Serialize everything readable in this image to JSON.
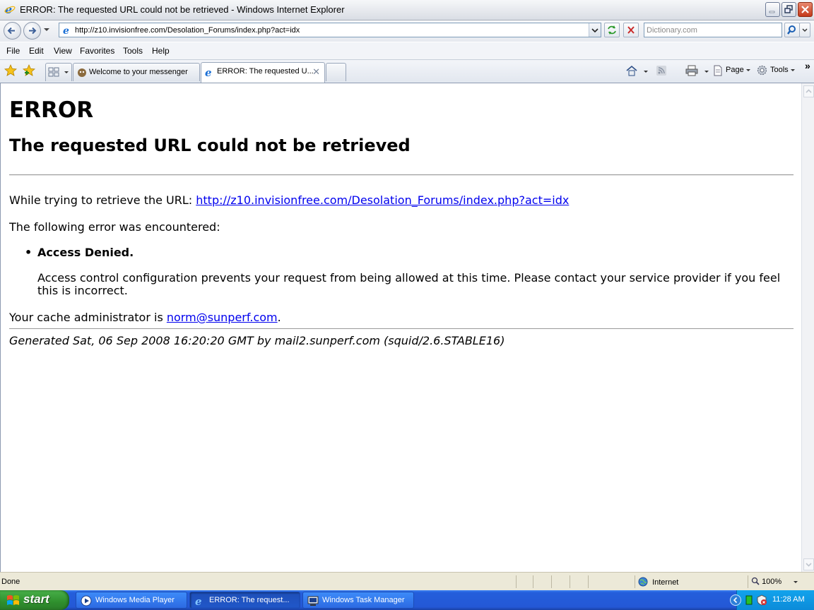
{
  "window": {
    "title": "ERROR: The requested URL could not be retrieved - Windows Internet Explorer"
  },
  "address": {
    "url": "http://z10.invisionfree.com/Desolation_Forums/index.php?act=idx"
  },
  "search": {
    "placeholder": "Dictionary.com"
  },
  "menu": {
    "items": [
      "File",
      "Edit",
      "View",
      "Favorites",
      "Tools",
      "Help"
    ]
  },
  "tabs": [
    {
      "label": "Welcome to your messenger"
    },
    {
      "label": "ERROR: The requested U..."
    }
  ],
  "command_bar": {
    "page_label": "Page",
    "tools_label": "Tools",
    "more_label": "»"
  },
  "page": {
    "heading": "ERROR",
    "subheading": "The requested URL could not be retrieved",
    "retrieve_prefix": "While trying to retrieve the URL: ",
    "retrieve_url": "http://z10.invisionfree.com/Desolation_Forums/index.php?act=idx",
    "error_intro": "The following error was encountered:",
    "error_title": "Access Denied.",
    "error_detail": "Access control configuration prevents your request from being allowed at this time. Please contact your service provider if you feel this is incorrect.",
    "admin_prefix": "Your cache administrator is ",
    "admin_email": "norm@sunperf.com",
    "admin_suffix": ".",
    "generated": "Generated Sat, 06 Sep 2008 16:20:20 GMT by mail2.sunperf.com (squid/2.6.STABLE16)"
  },
  "status": {
    "text": "Done",
    "zone": "Internet",
    "zoom": "100%"
  },
  "taskbar": {
    "start_label": "start",
    "tasks": [
      {
        "label": "Windows Media Player"
      },
      {
        "label": "ERROR: The request..."
      },
      {
        "label": "Windows Task Manager"
      }
    ],
    "clock": "11:28 AM"
  },
  "colors": {
    "link": "#0000ee",
    "taskbar": "#245edb",
    "start": "#2f8f2d"
  }
}
